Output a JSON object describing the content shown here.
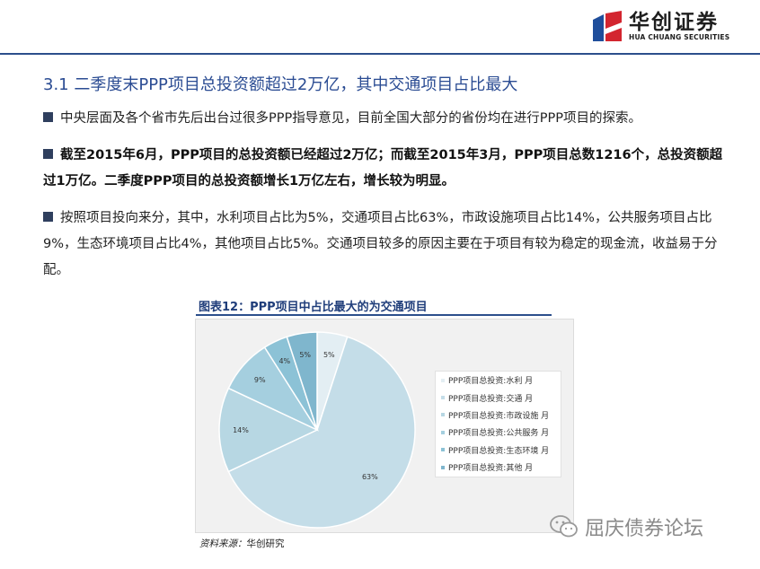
{
  "header": {
    "logo_cn": "华创证券",
    "logo_en": "HUA CHUANG SECURITIES"
  },
  "section_title": "3.1 二季度末PPP项目总投资额超过2万亿，其中交通项目占比最大",
  "paragraphs": [
    {
      "text": "中央层面及各个省市先后出台过很多PPP指导意见，目前全国大部分的省份均在进行PPP项目的探索。",
      "bold": false
    },
    {
      "text": "截至2015年6月，PPP项目的总投资额已经超过2万亿；而截至2015年3月，PPP项目总数1216个，总投资额超过1万亿。二季度PPP项目的总投资额增长1万亿左右，增长较为明显。",
      "bold": true
    },
    {
      "text": "按照项目投向来分，其中，水利项目占比为5%，交通项目占比63%，市政设施项目占比14%，公共服务项目占比9%，生态环境项目占比4%，其他项目占比5%。交通项目较多的原因主要在于项目有较为稳定的现金流，收益易于分配。",
      "bold": false
    }
  ],
  "figure": {
    "title": "图表12：PPP项目中占比最大的为交通项目",
    "source_label": "资料来源：",
    "source_value": "华创研究"
  },
  "chart_data": {
    "type": "pie",
    "title": "",
    "categories": [
      "PPP项目总投资:水利 月",
      "PPP项目总投资:交通 月",
      "PPP项目总投资:市政设施 月",
      "PPP项目总投资:公共服务 月",
      "PPP项目总投资:生态环境 月",
      "PPP项目总投资:其他 月"
    ],
    "values": [
      5,
      63,
      14,
      9,
      4,
      5
    ],
    "data_labels": [
      "5%",
      "63%",
      "14%",
      "9%",
      "4%",
      "5%"
    ],
    "colors": [
      "#e3eef3",
      "#c4dde8",
      "#b7d7e3",
      "#a5cfdf",
      "#8cc2d6",
      "#7fb6cd"
    ],
    "legend_position": "right"
  },
  "watermark": {
    "text": "屈庆债券论坛"
  },
  "colors": {
    "accent": "#2b4c93",
    "logo_red": "#d3252f",
    "logo_blue": "#1f4e9b"
  }
}
